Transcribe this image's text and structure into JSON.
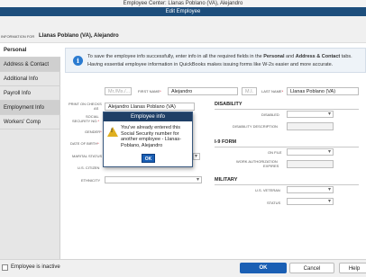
{
  "window": {
    "title": "Employee Center: Llanas Poblano (VA), Alejandro"
  },
  "tab": {
    "label": "Edit Employee"
  },
  "info_bar": {
    "label": "INFORMATION FOR",
    "name": "Llanas Poblano (VA), Alejandro"
  },
  "sidebar": {
    "items": [
      {
        "label": "Personal"
      },
      {
        "label": "Address & Contact"
      },
      {
        "label": "Additional Info"
      },
      {
        "label": "Payroll Info"
      },
      {
        "label": "Employment Info"
      },
      {
        "label": "Workers' Comp"
      }
    ]
  },
  "info_msg": {
    "line1_a": "To save the employee info successfully, enter info in all the required fields in the ",
    "line1_b": "Personal",
    "line1_c": " and ",
    "line1_d": "Address & Contact",
    "line1_e": " tabs.",
    "line2": "Having essential employee information in QuickBooks makes issuing forms like W-2s easier and more accurate."
  },
  "form": {
    "salutation_placeholder": "Mr./Ms./...",
    "first_name_label": "FIRST NAME",
    "first_name_value": "Alejandro",
    "mi_placeholder": "M.I.",
    "last_name_label": "LAST NAME",
    "last_name_value": "Llanas Poblano (VA)",
    "print_on_checks_label_1": "PRINT ON CHECKS",
    "print_on_checks_label_2": "AS",
    "print_on_checks_value": "Alejandro Llanas Poblano (VA)",
    "ssn_label_1": "SOCIAL",
    "ssn_label_2": "SECURITY NO.",
    "gender_label": "GENDER",
    "dob_label": "DATE OF BIRTH",
    "marital_label": "MARITAL STATUS",
    "citizen_label": "U.S. CITIZEN",
    "ethnicity_label": "ETHNICITY"
  },
  "disability": {
    "heading": "DISABILITY",
    "disabled_label": "DISABLED",
    "description_label": "DISABILITY DESCRIPTION"
  },
  "i9": {
    "heading": "I-9 FORM",
    "on_file_label": "ON FILE",
    "work_auth_label_1": "WORK AUTHORIZATION",
    "work_auth_label_2": "EXPIRES"
  },
  "military": {
    "heading": "MILITARY",
    "veteran_label": "U.S. VETERAN",
    "status_label": "STATUS"
  },
  "dialog": {
    "title": "Employee info",
    "message": "You've already entered this Social Security number for another employee - Llanas-Poblano, Alejandro",
    "ok_label": "OK"
  },
  "bottom": {
    "inactive_label": "Employee is inactive",
    "ok_label": "OK",
    "cancel_label": "Cancel",
    "help_label": "Help"
  },
  "colors": {
    "accent": "#1a5fb4",
    "header": "#1d4e7c",
    "required": "#d0021b",
    "warning": "#e0b020"
  },
  "icons": {
    "info": "info-icon",
    "warning": "warning-icon",
    "dropdown": "chevron-down-icon"
  }
}
